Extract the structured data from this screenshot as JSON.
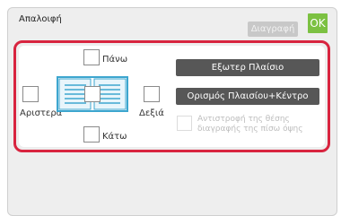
{
  "header": {
    "title": "Απαλοιφή",
    "delete_label": "Διαγραφή",
    "ok_label": "OK"
  },
  "options": {
    "top_label": "Πάνω",
    "left_label": "Αριστερά",
    "right_label": "Δεξιά",
    "bottom_label": "Κάτω",
    "outer_frame_label": "Εξωτερ Πλαίσιο",
    "frame_center_label": "Ορισμός Πλαισίου+Κέντρο",
    "reverse_back_label": "Αντιστροφή της θέσης διαγραφής της πίσω όψης"
  },
  "colors": {
    "ok_green": "#7cc142",
    "highlight_red": "#d8243f",
    "button_dark": "#575757",
    "diagram_blue": "#3da6cf"
  }
}
